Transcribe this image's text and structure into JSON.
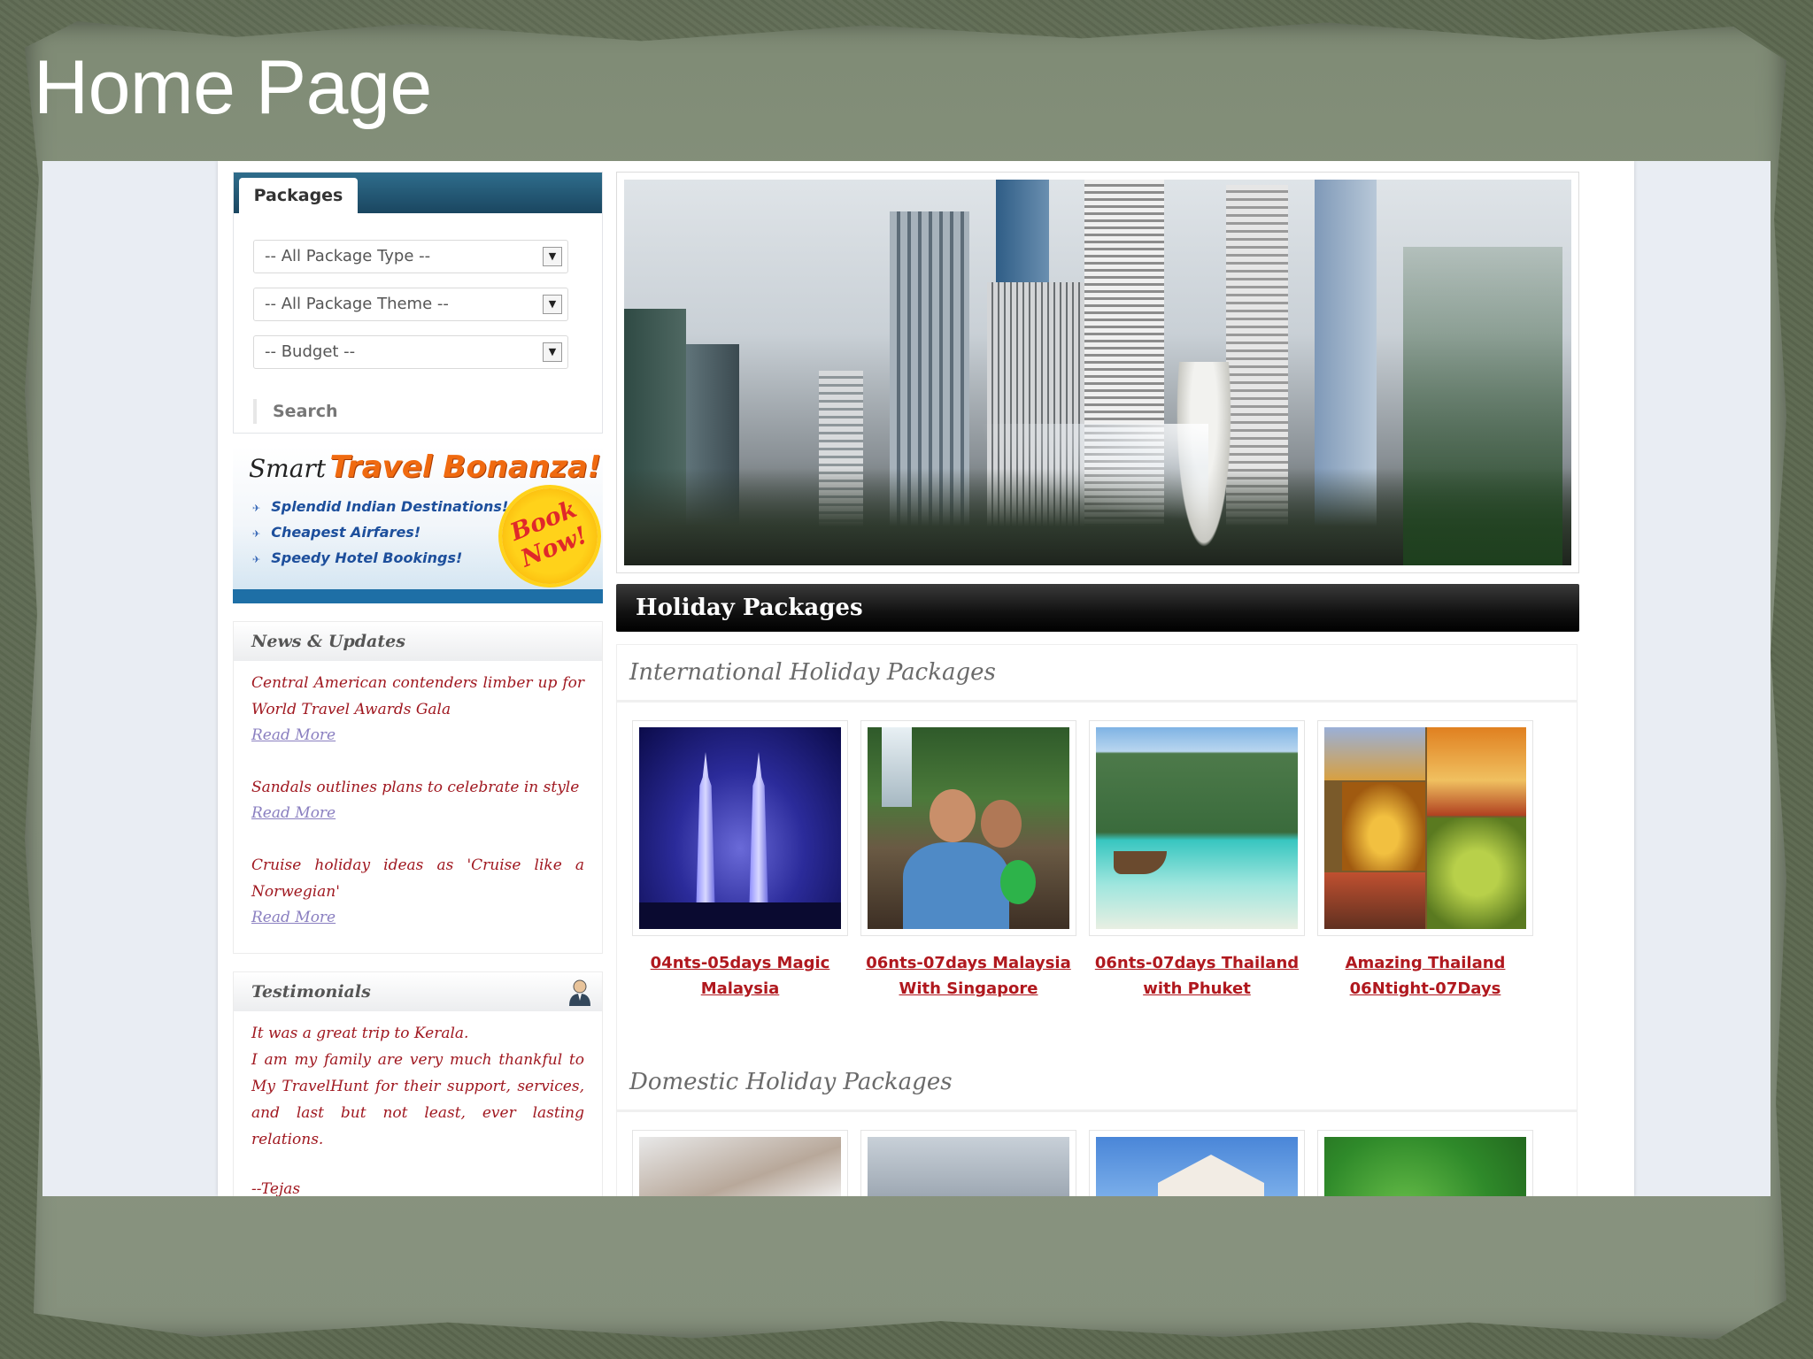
{
  "slide": {
    "title": "Home Page"
  },
  "packages_box": {
    "tab_label": "Packages",
    "selects": [
      {
        "value": "-- All Package Type --"
      },
      {
        "value": "-- All Package Theme --"
      },
      {
        "value": "-- Budget --"
      }
    ],
    "search_label": "Search"
  },
  "promo": {
    "smart": "Smart",
    "title": "Travel Bonanza!",
    "items": [
      "Splendid Indian Destinations!",
      "Cheapest Airfares!",
      "Speedy Hotel Bookings!"
    ],
    "badge_line1": "Book",
    "badge_line2": "Now!"
  },
  "news": {
    "heading": "News & Updates",
    "items": [
      {
        "text": "Central American contenders limber up for World Travel Awards Gala",
        "link": "Read More"
      },
      {
        "text": "Sandals outlines plans to celebrate in style",
        "link": "Read More"
      },
      {
        "text": "Cruise holiday ideas as 'Cruise like a Norwegian'",
        "link": "Read More"
      }
    ]
  },
  "testimonials": {
    "heading": "Testimonials",
    "line1": "It was a great trip to Kerala.",
    "body": "I am my family are very much thankful to My TravelHunt for their support, services, and last but not least, ever lasting relations.",
    "author": "--Tejas"
  },
  "main": {
    "bar_title": "Holiday Packages",
    "international": {
      "title": "International Holiday Packages",
      "packages": [
        {
          "line1": "04nts-05days Magic",
          "line2": "Malaysia"
        },
        {
          "line1": "06nts-07days Malaysia",
          "line2": "With Singapore"
        },
        {
          "line1": "06nts-07days Thailand",
          "line2": "with Phuket"
        },
        {
          "line1": "Amazing Thailand",
          "line2": "06Ntight-07Days"
        }
      ]
    },
    "domestic": {
      "title": "Domestic Holiday Packages"
    }
  },
  "colors": {
    "accent_link": "#b0181e",
    "header_bar": "#000000",
    "tab_bar": "#1a4660",
    "promo_orange": "#f06a10"
  }
}
